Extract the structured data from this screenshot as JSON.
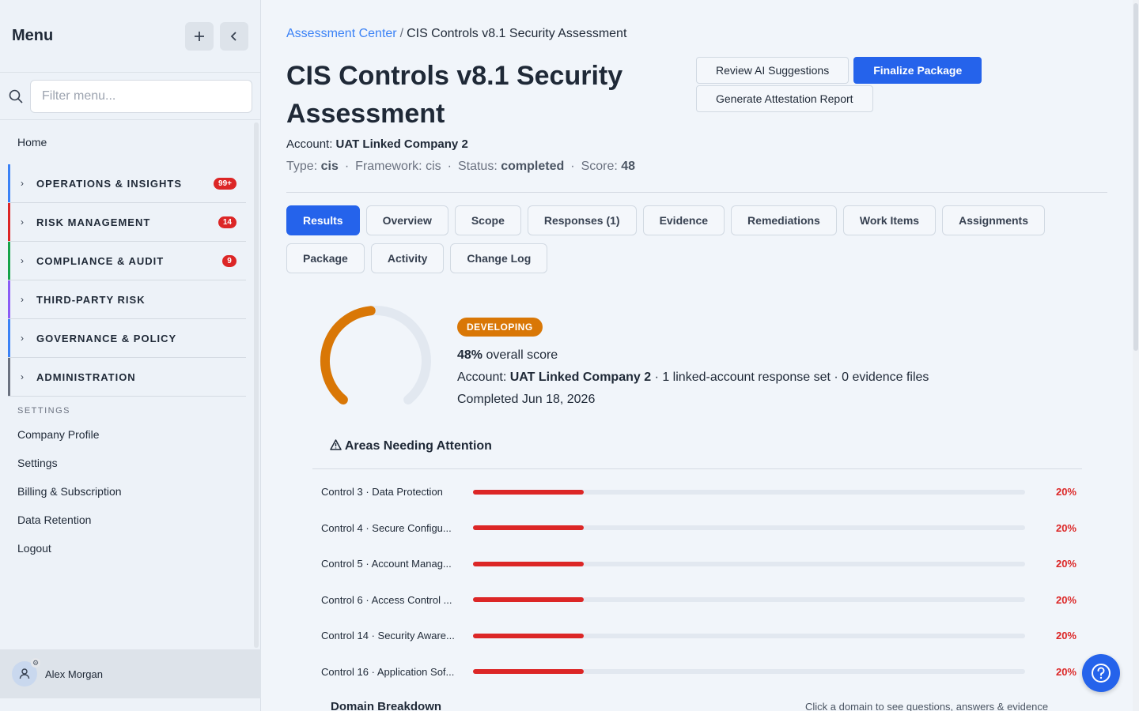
{
  "sidebar": {
    "title": "Menu",
    "add_icon": "plus-icon",
    "collapse_icon": "chevron-left-icon",
    "search": {
      "placeholder": "Filter menu...",
      "icon": "search-icon"
    },
    "home": "Home",
    "sections": [
      {
        "label": "OPERATIONS & INSIGHTS",
        "badge": "99+",
        "color": "#3b82f6"
      },
      {
        "label": "RISK MANAGEMENT",
        "badge": "14",
        "color": "#dc2626"
      },
      {
        "label": "COMPLIANCE & AUDIT",
        "badge": "9",
        "color": "#16a34a"
      },
      {
        "label": "THIRD-PARTY RISK",
        "badge": "",
        "color": "#8b5cf6"
      },
      {
        "label": "GOVERNANCE & POLICY",
        "badge": "",
        "color": "#3b82f6"
      },
      {
        "label": "ADMINISTRATION",
        "badge": "",
        "color": "#6b7280"
      }
    ],
    "settings_label": "SETTINGS",
    "links": [
      "Company Profile",
      "Settings",
      "Billing & Subscription",
      "Data Retention",
      "Logout"
    ],
    "user": "Alex Morgan"
  },
  "breadcrumb": {
    "parent": "Assessment Center",
    "separator": "/",
    "current": "CIS Controls v8.1 Security Assessment"
  },
  "page_title": "CIS Controls v8.1 Security Assessment",
  "actions": {
    "review": "Review AI Suggestions",
    "finalize": "Finalize Package",
    "attestation": "Generate Attestation Report"
  },
  "meta": {
    "account_label": "Account:",
    "account": "UAT Linked Company 2",
    "type_label": "Type:",
    "type": "cis",
    "framework": "Framework: cis",
    "status_label": "Status:",
    "status": "completed",
    "score_label": "Score:",
    "score": "48"
  },
  "tabs": [
    "Results",
    "Overview",
    "Scope",
    "Responses (1)",
    "Evidence",
    "Remediations",
    "Work Items",
    "Assignments",
    "Package",
    "Activity",
    "Change Log"
  ],
  "active_tab": "Results",
  "summary": {
    "level": "DEVELOPING",
    "score_pct": "48%",
    "score_suffix": "overall score",
    "gauge_value": 0.48,
    "gauge_color": "#d97706",
    "account_prefix": "Account:",
    "account": "UAT Linked Company 2",
    "account_suffix": "· 1 linked-account response set · 0 evidence files",
    "completed": "Completed Jun 18, 2026"
  },
  "attention": {
    "title": "Areas Needing Attention",
    "icon": "warning-icon",
    "items": [
      {
        "name": "Control 3 · Data Protection",
        "value": 0.2,
        "pct": "20%"
      },
      {
        "name": "Control 4 · Secure Configu...",
        "value": 0.2,
        "pct": "20%"
      },
      {
        "name": "Control 5 · Account Manag...",
        "value": 0.2,
        "pct": "20%"
      },
      {
        "name": "Control 6 · Access Control ...",
        "value": 0.2,
        "pct": "20%"
      },
      {
        "name": "Control 14 · Security Aware...",
        "value": 0.2,
        "pct": "20%"
      },
      {
        "name": "Control 16 · Application Sof...",
        "value": 0.2,
        "pct": "20%"
      }
    ]
  },
  "domain": {
    "title": "Domain Breakdown",
    "hint": "Click a domain to see questions, answers & evidence"
  },
  "help_icon": "help-icon"
}
